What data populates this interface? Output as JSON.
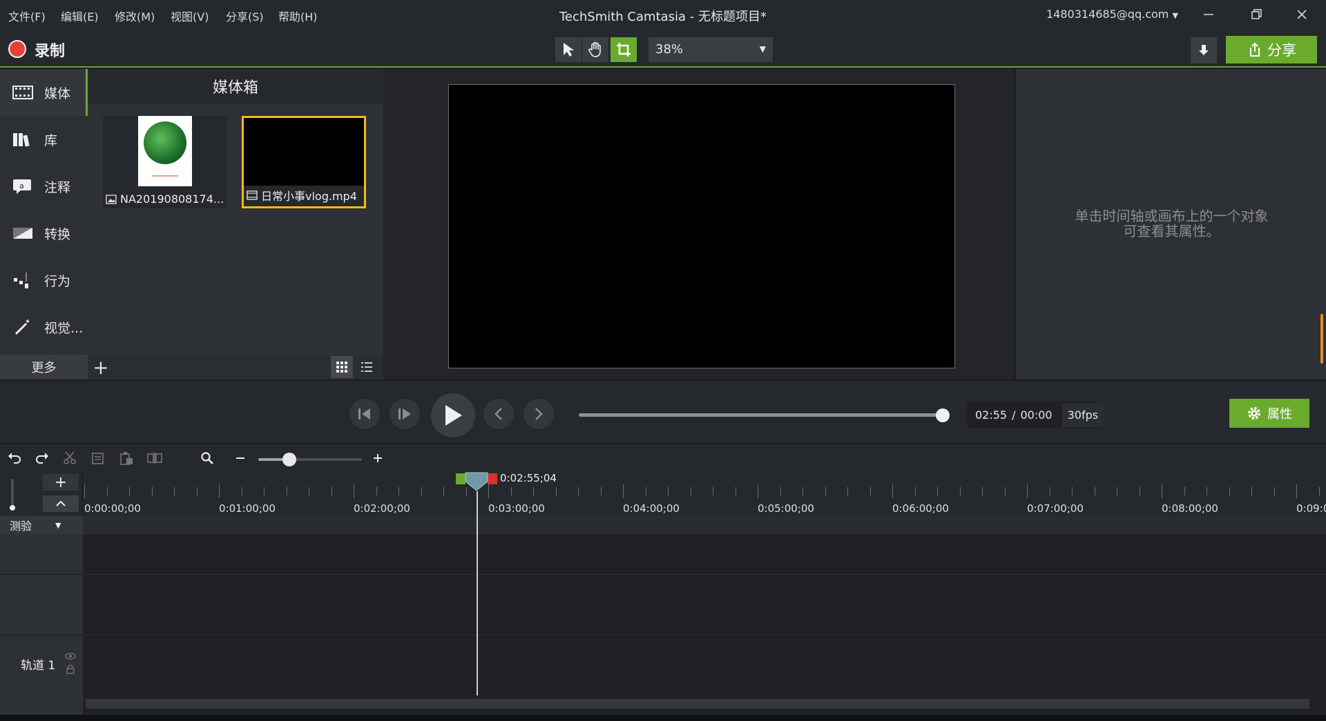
{
  "menu": [
    "文件(F)",
    "编辑(E)",
    "修改(M)",
    "视图(V)",
    "分享(S)",
    "帮助(H)"
  ],
  "app_title": "TechSmith Camtasia - 无标题项目*",
  "account": "1480314685@qq.com",
  "toolbar": {
    "record_label": "录制",
    "zoom": "38%",
    "share_label": "分享"
  },
  "nav": {
    "items": [
      "媒体",
      "库",
      "注释",
      "转换",
      "行为",
      "视觉..."
    ],
    "more": "更多"
  },
  "media_bin": {
    "title": "媒体箱",
    "items": [
      {
        "name": "NA20190808174...",
        "type": "image"
      },
      {
        "name": "日常小事vlog.mp4",
        "type": "video"
      }
    ]
  },
  "properties": {
    "hint_line1": "单击时间轴或画布上的一个对象",
    "hint_line2": "可查看其属性。",
    "button_label": "属性"
  },
  "playback": {
    "current_time": "02:55",
    "separator": "/",
    "total_time": "00:00",
    "fps": "30fps",
    "progress": 1.0
  },
  "timeline": {
    "playhead_time": "0:02:55;04",
    "ruler": [
      "0:00:00;00",
      "0:01:00;00",
      "0:02:00;00",
      "0:03:00;00",
      "0:04:00;00",
      "0:05:00;00",
      "0:06:00;00",
      "0:07:00;00",
      "0:08:00;00",
      "0:09:0"
    ],
    "group_name": "测验",
    "track_name": "轨道 1"
  },
  "colors": {
    "accent_green": "#6aab2e",
    "selection_yellow": "#f5b823",
    "record_red": "#e8403a"
  }
}
